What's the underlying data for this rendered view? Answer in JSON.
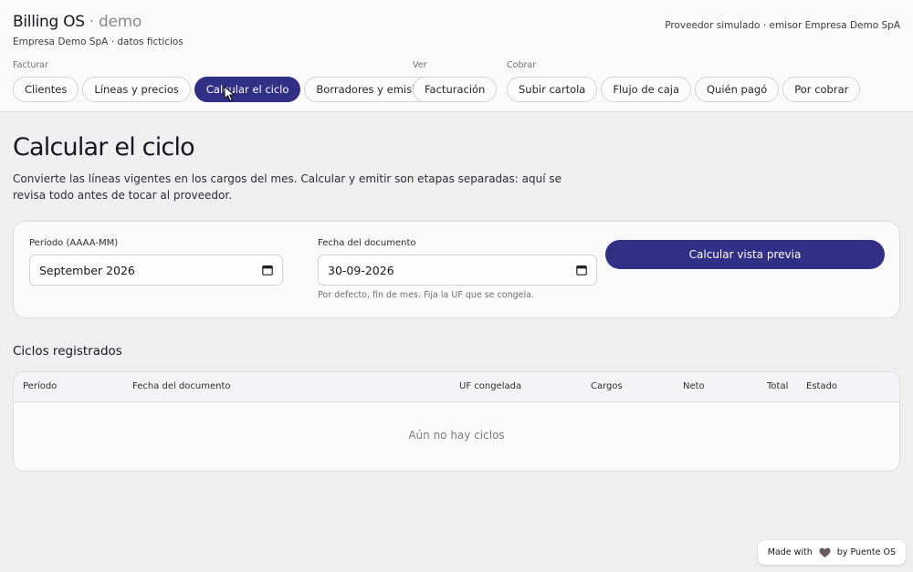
{
  "header": {
    "brand": "Billing OS",
    "brand_sep": " · ",
    "brand_demo": "demo",
    "subtitle": "Empresa Demo SpA · datos ficticios",
    "provider": "Proveedor simulado · emisor Empresa Demo SpA"
  },
  "nav": {
    "groups": {
      "facturar": "Facturar",
      "ver": "Ver",
      "cobrar": "Cobrar"
    },
    "facturar_items": [
      "Clientes",
      "Líneas y precios",
      "Calcular el ciclo",
      "Borradores y emisión"
    ],
    "ver_items": [
      "Facturación"
    ],
    "cobrar_items": [
      "Subir cartola",
      "Flujo de caja",
      "Quién pagó",
      "Por cobrar"
    ],
    "active": "Calcular el ciclo"
  },
  "page": {
    "title": "Calcular el ciclo",
    "description": "Convierte las líneas vigentes en los cargos del mes. Calcular y emitir son etapas separadas: aquí se revisa todo antes de tocar al proveedor."
  },
  "form": {
    "period_label": "Período (AAAA-MM)",
    "period_value": "September  2026",
    "date_label": "Fecha del documento",
    "date_value": "30-09-2026",
    "date_hint": "Por defecto, fin de mes. Fija la UF que se congela.",
    "submit_label": "Calcular vista previa"
  },
  "cycles": {
    "title": "Ciclos registrados",
    "columns": [
      "Período",
      "Fecha del documento",
      "UF congelada",
      "Cargos",
      "Neto",
      "Total",
      "Estado"
    ],
    "empty": "Aún no hay ciclos"
  },
  "badge": {
    "prefix": "Made with",
    "suffix": "by Puente OS"
  },
  "colors": {
    "accent": "#322f86",
    "background": "#efeff0"
  },
  "icons": {
    "calendar": "calendar-icon",
    "heart": "heart-icon",
    "cursor": "pointer-cursor-icon"
  }
}
